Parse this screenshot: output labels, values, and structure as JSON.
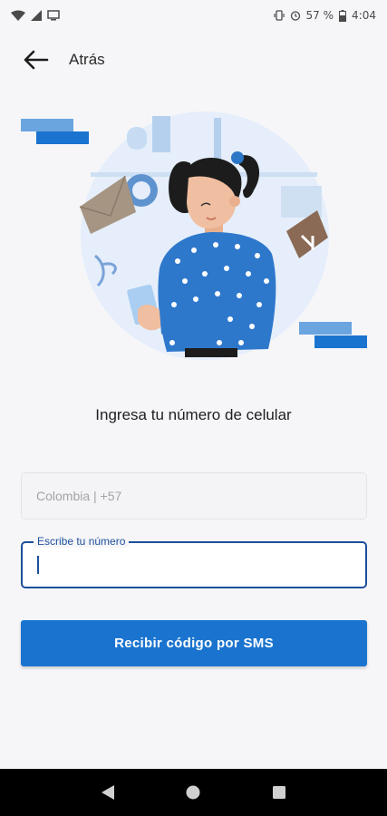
{
  "status_bar": {
    "battery_percent": "57 %",
    "time": "4:04",
    "icons": [
      "wifi-icon",
      "signal-icon",
      "screen-cast-icon",
      "vibrate-icon",
      "alarm-icon",
      "battery-icon"
    ]
  },
  "header": {
    "back_label": "Atrás"
  },
  "main": {
    "title": "Ingresa tu número de celular",
    "country_field": {
      "value": "Colombia | +57"
    },
    "phone_field": {
      "label": "Escribe tu número",
      "value": ""
    },
    "sms_button": "Recibir código por SMS"
  },
  "nav_bar": {
    "icons": [
      "back-triangle-icon",
      "home-circle-icon",
      "recents-square-icon"
    ]
  },
  "colors": {
    "primary": "#1a74cf",
    "focus": "#1d4f9a",
    "background": "#f6f6f9"
  }
}
